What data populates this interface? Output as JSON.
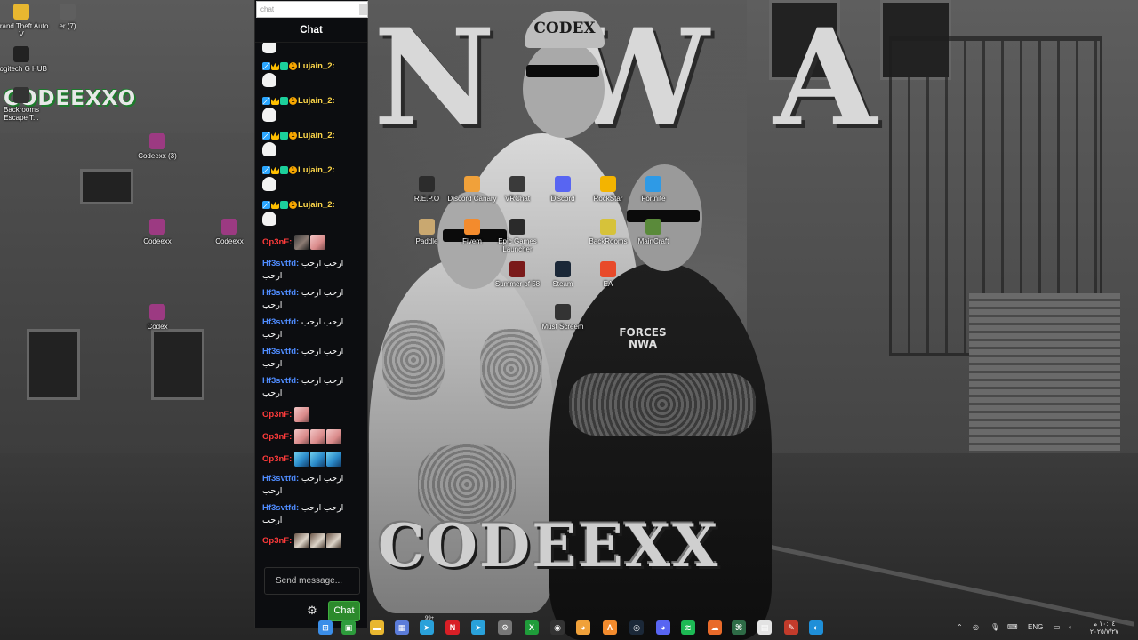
{
  "wallpaper": {
    "title_top": "N W A",
    "title_bottom": "CODEEXX",
    "logo": "CODEEXXO",
    "cap_text": "CODEX",
    "badge_text": "FORCES NWA"
  },
  "desktop_icons": [
    {
      "label": "Grand Theft Auto V",
      "icon": "folder-icon",
      "color": "#e8b730"
    },
    {
      "label": "er (7)",
      "icon": "app-icon",
      "color": "#5f5f5f"
    },
    {
      "label": "Logitech G HUB",
      "icon": "logitech-icon",
      "color": "#222222"
    },
    {
      "label": "Backrooms Escape T...",
      "icon": "game-icon",
      "color": "#333333"
    },
    {
      "label": "Codeexx (3)",
      "icon": "archive-icon",
      "color": "#9c3a82"
    },
    {
      "label": "Codeexx",
      "icon": "archive-icon",
      "color": "#9c3a82"
    },
    {
      "label": "Codeexx",
      "icon": "archive-icon",
      "color": "#9c3a82"
    },
    {
      "label": "Codex",
      "icon": "archive-icon",
      "color": "#9c3a82"
    },
    {
      "label": "R.E.P.O",
      "icon": "game-icon",
      "color": "#2c2c2c"
    },
    {
      "label": "Discord Canary",
      "icon": "discord-canary-icon",
      "color": "#f0a13a"
    },
    {
      "label": "VRChat",
      "icon": "vr-icon",
      "color": "#3a3a3a"
    },
    {
      "label": "Discord",
      "icon": "discord-icon",
      "color": "#5865f2"
    },
    {
      "label": "RockStar",
      "icon": "rockstar-icon",
      "color": "#f4b400"
    },
    {
      "label": "Fortnite",
      "icon": "fortnite-icon",
      "color": "#2e9ae6"
    },
    {
      "label": "Paddle",
      "icon": "game-icon",
      "color": "#c9a870"
    },
    {
      "label": "Fivem",
      "icon": "fivem-icon",
      "color": "#f38b2d"
    },
    {
      "label": "Epic Games Launcher",
      "icon": "epic-icon",
      "color": "#2a2a2a"
    },
    {
      "label": "BackRooms",
      "icon": "game-icon",
      "color": "#d6c23a"
    },
    {
      "label": "MainCraft",
      "icon": "minecraft-icon",
      "color": "#5a8a3a"
    },
    {
      "label": "Summer of 58",
      "icon": "game-icon",
      "color": "#7a1a1a"
    },
    {
      "label": "Steam",
      "icon": "steam-icon",
      "color": "#1b2838"
    },
    {
      "label": "EA",
      "icon": "ea-icon",
      "color": "#e84a2a"
    },
    {
      "label": "Must Screem",
      "icon": "game-icon",
      "color": "#333333"
    }
  ],
  "chat": {
    "search_placeholder": "chat",
    "header": "Chat",
    "messages": [
      {
        "user": "",
        "text": "",
        "type": "avatar"
      },
      {
        "user": "Lujain_2:",
        "color": "gold",
        "type": "badged"
      },
      {
        "user": "Lujain_2:",
        "color": "gold",
        "type": "badged"
      },
      {
        "user": "Lujain_2:",
        "color": "gold",
        "type": "badged"
      },
      {
        "user": "Lujain_2:",
        "color": "gold",
        "type": "badged"
      },
      {
        "user": "Lujain_2:",
        "color": "gold",
        "type": "badged"
      },
      {
        "user": "Op3nF:",
        "color": "red",
        "emotes": [
          "dark",
          "pink"
        ]
      },
      {
        "user": "Hf3svtfd:",
        "color": "blue",
        "text": "ارحب ارحب ارحب"
      },
      {
        "user": "Hf3svtfd:",
        "color": "blue",
        "text": "ارحب ارحب ارحب"
      },
      {
        "user": "Hf3svtfd:",
        "color": "blue",
        "text": "ارحب ارحب ارحب"
      },
      {
        "user": "Hf3svtfd:",
        "color": "blue",
        "text": "ارحب ارحب ارحب"
      },
      {
        "user": "Hf3svtfd:",
        "color": "blue",
        "text": "ارحب ارحب ارحب"
      },
      {
        "user": "Op3nF:",
        "color": "red",
        "emotes": [
          "pink"
        ]
      },
      {
        "user": "Op3nF:",
        "color": "red",
        "emotes": [
          "pink",
          "pink",
          "pink"
        ]
      },
      {
        "user": "Op3nF:",
        "color": "red",
        "emotes": [
          "blue",
          "blue",
          "blue"
        ]
      },
      {
        "user": "Hf3svtfd:",
        "color": "blue",
        "text": "ارحب ارحب ارحب"
      },
      {
        "user": "Hf3svtfd:",
        "color": "blue",
        "text": "ارحب ارحب ارحب"
      },
      {
        "user": "Op3nF:",
        "color": "red",
        "emotes": [
          "brown",
          "brown",
          "brown"
        ]
      }
    ],
    "input_placeholder": "Send message...",
    "send_label": "Chat",
    "settings_icon": "gear-icon"
  },
  "taskbar": {
    "apps": [
      {
        "icon": "start-icon",
        "color": "#3b8ee8",
        "glyph": "⊞"
      },
      {
        "icon": "task-view-icon",
        "color": "#2d9c3c",
        "glyph": "▣"
      },
      {
        "icon": "file-explorer-icon",
        "color": "#e8b730",
        "glyph": "▬"
      },
      {
        "icon": "store-icon",
        "color": "#5b7cd9",
        "glyph": "▦"
      },
      {
        "icon": "telegram-icon",
        "color": "#2aa1da",
        "glyph": "➤"
      },
      {
        "icon": "netflix-icon",
        "color": "#d81f26",
        "glyph": "N"
      },
      {
        "icon": "telegram-icon",
        "color": "#2aa1da",
        "glyph": "➤"
      },
      {
        "icon": "settings-icon",
        "color": "#777777",
        "glyph": "⚙"
      },
      {
        "icon": "xbox-icon",
        "color": "#1f9c3a",
        "glyph": "X"
      },
      {
        "icon": "obs-icon",
        "color": "#333333",
        "glyph": "◉"
      },
      {
        "icon": "discord-canary-icon",
        "color": "#f0a13a",
        "glyph": "◕"
      },
      {
        "icon": "fivem-icon",
        "color": "#f38b2d",
        "glyph": "Λ"
      },
      {
        "icon": "steam-icon",
        "color": "#1b2838",
        "glyph": "◎"
      },
      {
        "icon": "discord-icon",
        "color": "#5865f2",
        "glyph": "◕"
      },
      {
        "icon": "spotify-icon",
        "color": "#1db954",
        "glyph": "≋"
      },
      {
        "icon": "cloud-icon",
        "color": "#e86a2a",
        "glyph": "☁"
      },
      {
        "icon": "terminal-icon",
        "color": "#2e6b46",
        "glyph": "⌘"
      },
      {
        "icon": "notes-icon",
        "color": "#e3e3e3",
        "glyph": "▤"
      },
      {
        "icon": "paint-icon",
        "color": "#c23b2b",
        "glyph": "✎"
      },
      {
        "icon": "edge-icon",
        "color": "#1f8fd8",
        "glyph": "◐"
      }
    ],
    "notification_badge": "99+",
    "language": "ENG",
    "clock": "١٠:٠٤ م",
    "date": "٢٠٢٥/٧/٢٧"
  }
}
